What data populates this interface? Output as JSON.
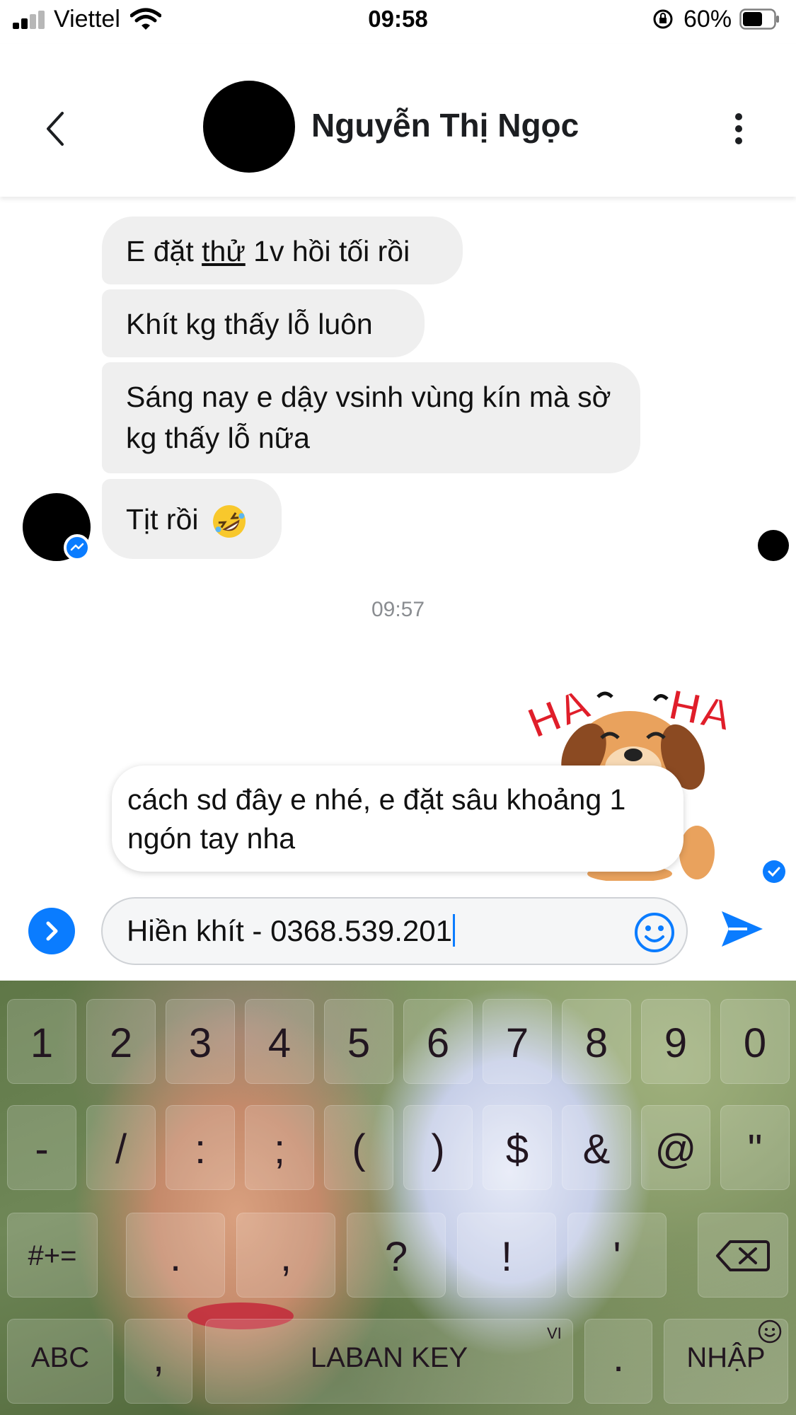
{
  "status_bar": {
    "carrier": "Viettel",
    "time": "09:58",
    "battery": "60%"
  },
  "header": {
    "contact_name": "Nguyễn Thị Ngọc"
  },
  "messages": {
    "m1_before": "E đặt ",
    "m1_underline": "thử",
    "m1_after": " 1v hồi tối rồi",
    "m2": "Khít kg thấy lỗ luôn",
    "m3": "Sáng nay e dậy vsinh vùng kín mà sờ kg thấy lỗ nữa",
    "m4": "Tịt rồi",
    "m4_emoji": "rolling-on-floor-laughing-emoji",
    "timestamp": "09:57",
    "sticker": "haha-dog-sticker",
    "sent": "cách sd đây e nhé, e đặt sâu khoảng 1 ngón tay nha",
    "sticker_text_left": "HA",
    "sticker_text_right": "HA"
  },
  "composer": {
    "input_value": "Hiền khít - 0368.539.201"
  },
  "keyboard": {
    "row1": [
      "1",
      "2",
      "3",
      "4",
      "5",
      "6",
      "7",
      "8",
      "9",
      "0"
    ],
    "row2": [
      "-",
      "/",
      ":",
      ";",
      "(",
      ")",
      "$",
      "&",
      "@",
      "\""
    ],
    "row3": [
      "#+=",
      ".",
      ",",
      "?",
      "!",
      "'"
    ],
    "row4": [
      "ABC",
      ",",
      "LABAN KEY",
      ".",
      "NHẬP"
    ],
    "language": "VI"
  },
  "colors": {
    "accent": "#0a7cff",
    "bubble_gray": "#efefef"
  }
}
